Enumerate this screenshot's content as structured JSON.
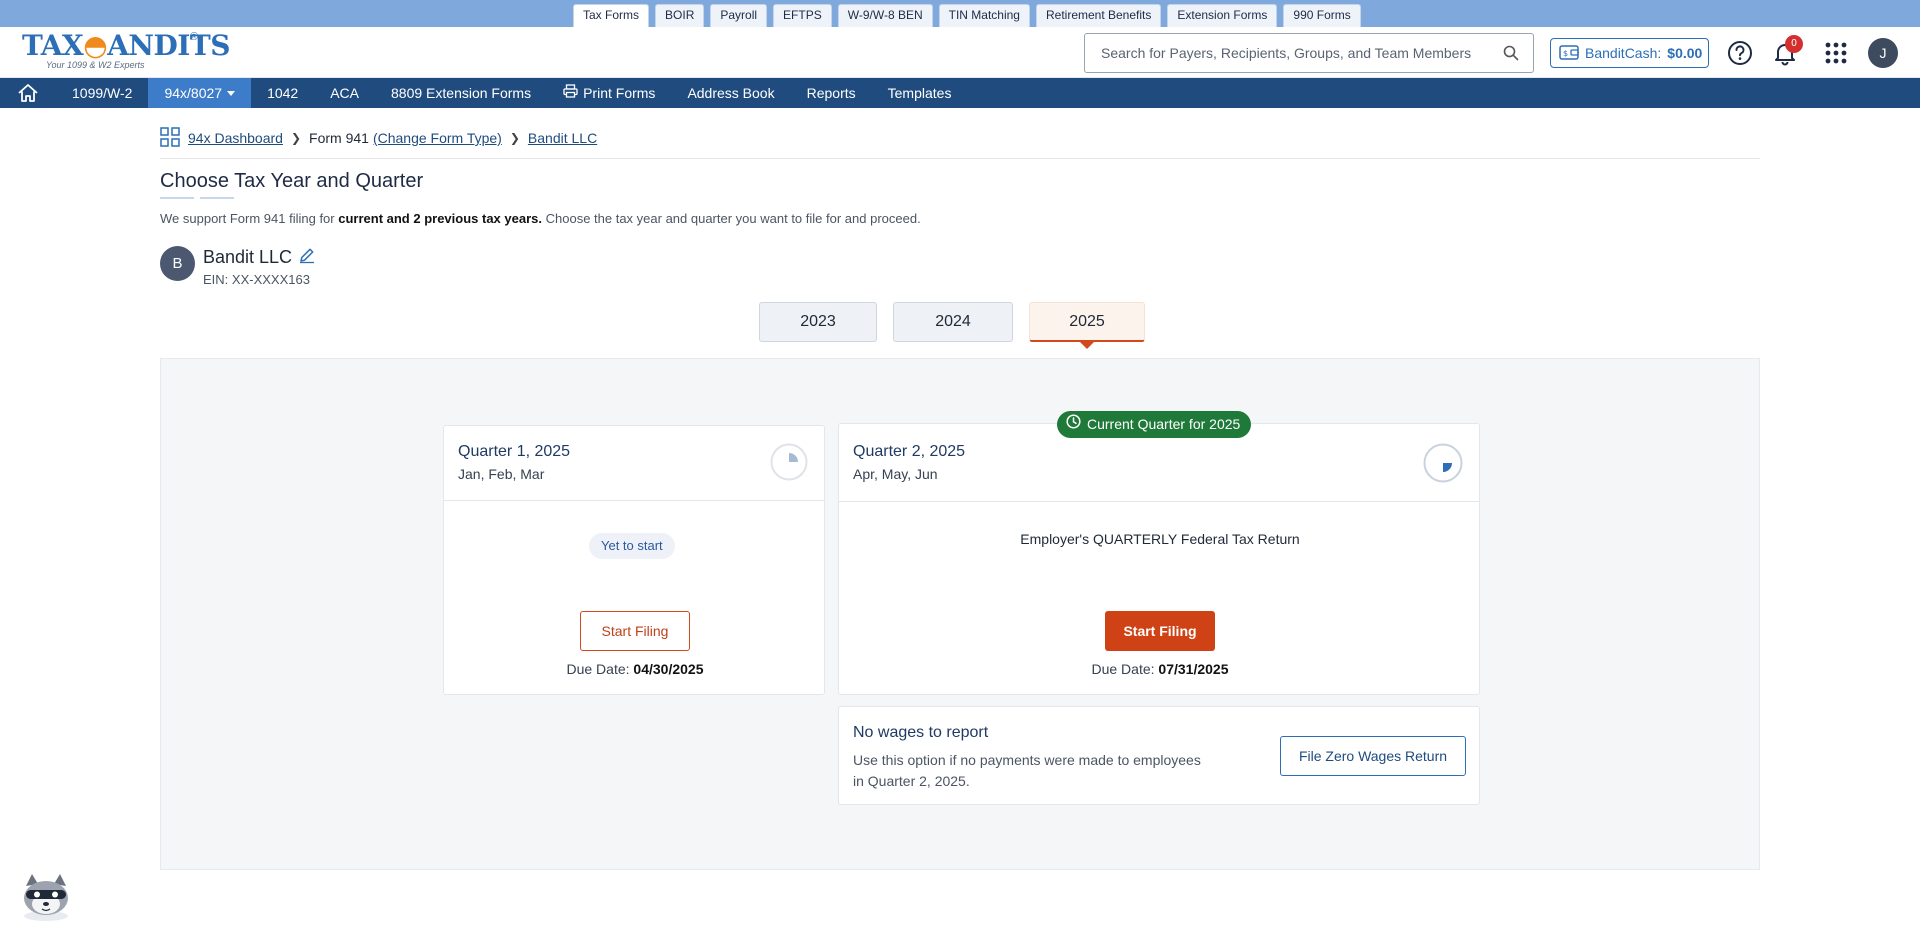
{
  "top_tabs": [
    "Tax Forms",
    "BOIR",
    "Payroll",
    "EFTPS",
    "W-9/W-8 BEN",
    "TIN Matching",
    "Retirement Benefits",
    "Extension Forms",
    "990 Forms"
  ],
  "logo": {
    "text_prefix": "TAX",
    "text_suffix": "ANDITS",
    "tagline": "Your 1099 & W2 Experts",
    "reg": "®"
  },
  "search": {
    "placeholder": "Search for Payers, Recipients, Groups, and Team Members"
  },
  "bandit_cash": {
    "label": "BanditCash:",
    "amount": "$0.00"
  },
  "notifications": {
    "count": "0"
  },
  "user": {
    "initial": "J"
  },
  "nav": {
    "items": [
      "1099/W-2",
      "94x/8027",
      "1042",
      "ACA",
      "8809 Extension Forms",
      "Print Forms",
      "Address Book",
      "Reports",
      "Templates"
    ]
  },
  "breadcrumb": {
    "dashboard": "94x Dashboard",
    "form": "Form 941",
    "change": "(Change Form Type)",
    "business": "Bandit LLC"
  },
  "page": {
    "title": "Choose Tax Year and Quarter",
    "subtitle_pre": "We support Form 941 filing for ",
    "subtitle_bold": "current and 2 previous tax years.",
    "subtitle_post": " Choose the tax year and quarter you want to file for and proceed."
  },
  "business": {
    "initial": "B",
    "name": "Bandit LLC",
    "ein": "EIN: XX-XXXX163"
  },
  "years": [
    "2023",
    "2024",
    "2025"
  ],
  "selected_year": "2025",
  "quarters": [
    {
      "title": "Quarter 1, 2025",
      "months": "Jan, Feb, Mar",
      "status": "Yet to start",
      "button": "Start Filing",
      "due_label": "Due Date:",
      "due_date": "04/30/2025"
    },
    {
      "title": "Quarter 2, 2025",
      "months": "Apr, May, Jun",
      "badge": "Current Quarter for 2025",
      "description": "Employer's QUARTERLY Federal Tax Return",
      "button": "Start Filing",
      "due_label": "Due Date:",
      "due_date": "07/31/2025"
    }
  ],
  "zero_wages": {
    "title": "No wages to report",
    "description": "Use this option if no payments were made to employees in Quarter 2, 2025.",
    "button": "File Zero Wages Return"
  },
  "colors": {
    "nav_bg": "#1f4b7f",
    "nav_active": "#3d7cc9",
    "accent_orange": "#cf4216",
    "badge_green": "#1f7a3a",
    "link_blue": "#1f4b7f"
  }
}
